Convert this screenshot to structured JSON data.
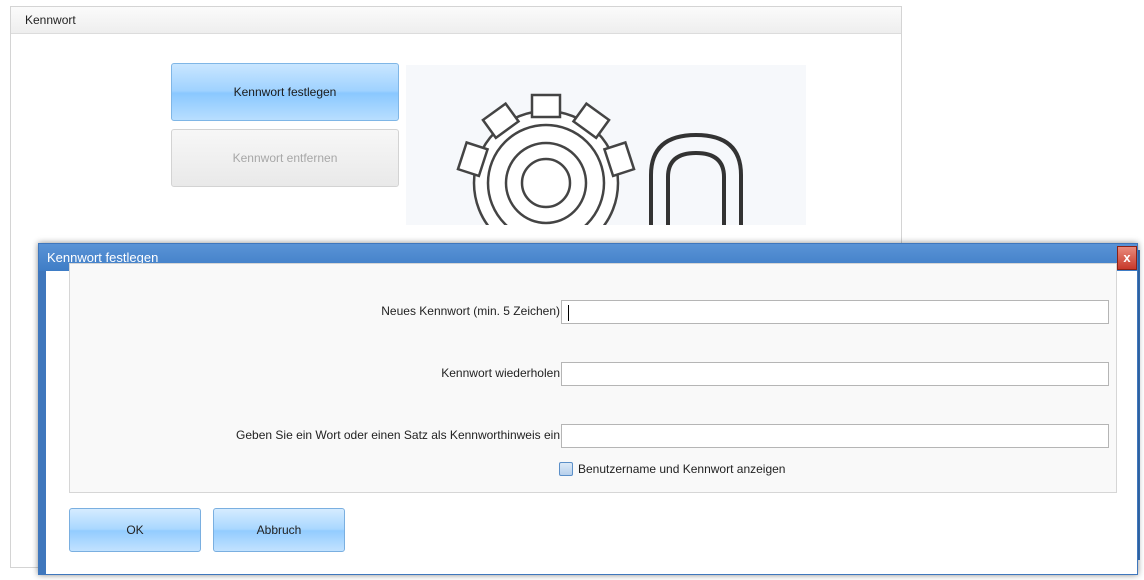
{
  "background_window": {
    "title": "Kennwort",
    "set_password_button": "Kennwort festlegen",
    "remove_password_button": "Kennwort entfernen"
  },
  "dialog": {
    "title": "Kennwort festlegen",
    "close_symbol": "x",
    "fields": [
      {
        "label": "Neues Kennwort  (min. 5 Zeichen)",
        "value": ""
      },
      {
        "label": "Kennwort wiederholen",
        "value": ""
      },
      {
        "label": "Geben Sie ein Wort oder einen Satz als Kennworthinweis ein",
        "value": ""
      }
    ],
    "show_credentials_checkbox": {
      "label": "Benutzername und Kennwort anzeigen",
      "checked": false
    },
    "ok_button": "OK",
    "cancel_button": "Abbruch"
  },
  "colors": {
    "titlebar": "#4a88cf",
    "primary_button": "#a4d4ff",
    "close_button": "#d9503f"
  },
  "icons": [
    "gear-icon",
    "lock-shackle-icon",
    "close-icon",
    "checkbox-icon"
  ]
}
